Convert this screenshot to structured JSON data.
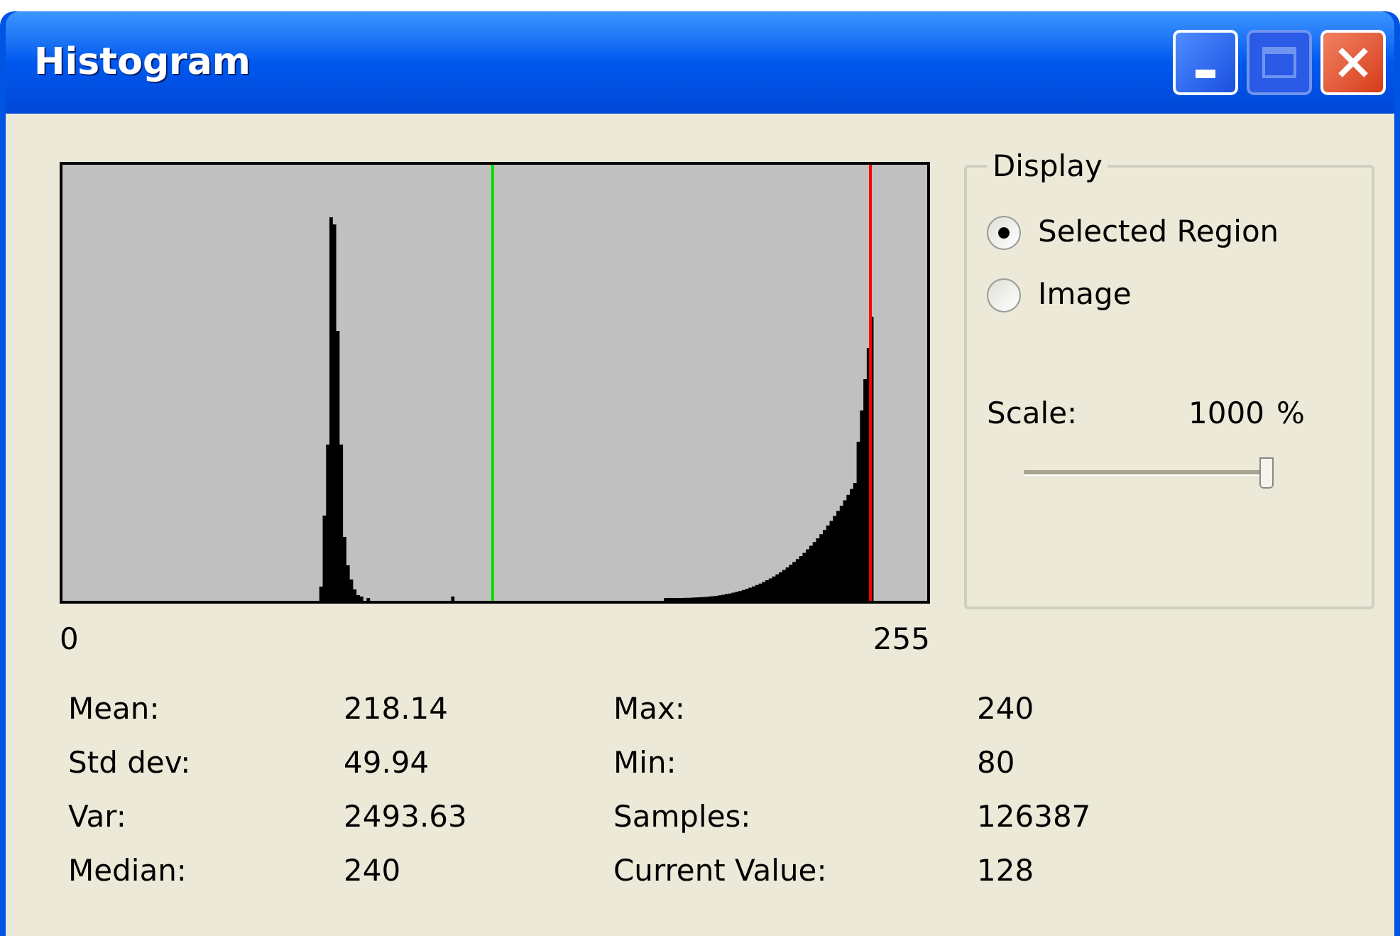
{
  "window": {
    "title": "Histogram"
  },
  "histogram": {
    "axis_min": "0",
    "axis_max": "255"
  },
  "display": {
    "title": "Display",
    "options": [
      {
        "label": "Selected Region",
        "selected": true
      },
      {
        "label": "Image",
        "selected": false
      }
    ],
    "scale": {
      "label": "Scale:",
      "value": "1000",
      "unit": "%",
      "level": 1
    }
  },
  "stats": [
    {
      "label": "Mean:",
      "value": "218.14"
    },
    {
      "label": "Std dev:",
      "value": "49.94"
    },
    {
      "label": "Var:",
      "value": "2493.63"
    },
    {
      "label": "Median:",
      "value": "240"
    },
    {
      "label": "Max:",
      "value": "240"
    },
    {
      "label": "Min:",
      "value": "80"
    },
    {
      "label": "Samples:",
      "value": "126387"
    },
    {
      "label": "Current Value:",
      "value": "128"
    }
  ]
}
